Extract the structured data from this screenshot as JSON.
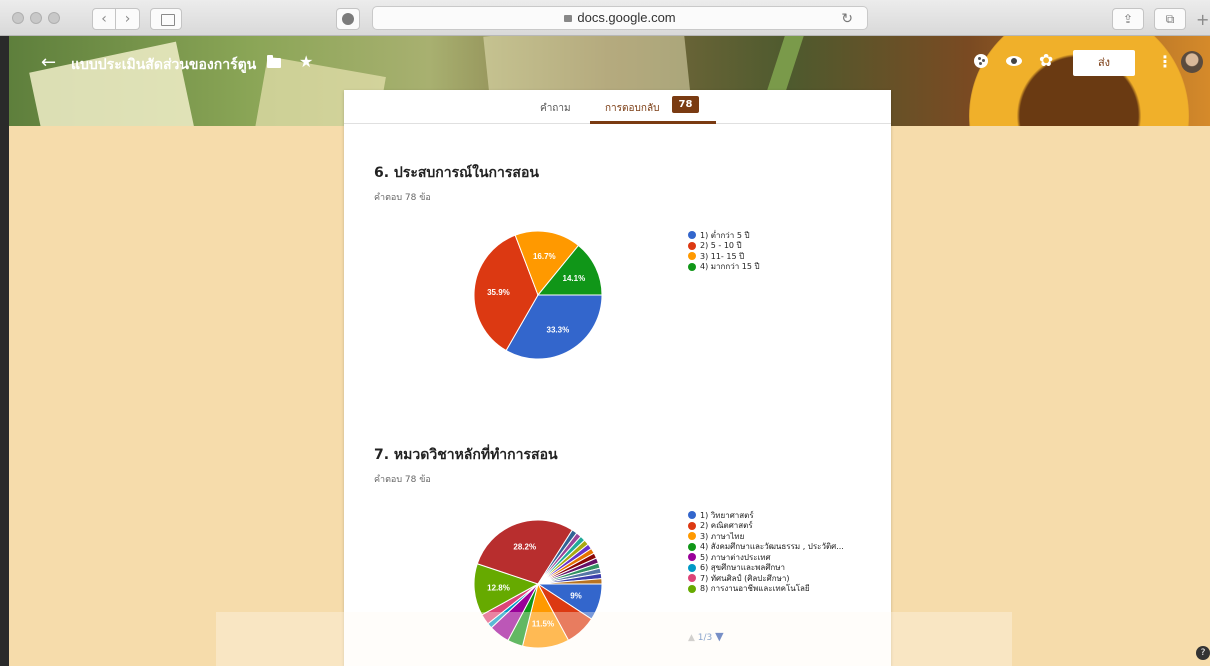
{
  "browser": {
    "url": "docs.google.com"
  },
  "header": {
    "title": "แบบประเมินสัดส่วนของการ์ตูน",
    "send_label": "ส่ง"
  },
  "tabs": {
    "questions_label": "คำถาม",
    "responses_label": "การตอบกลับ",
    "responses_count": "78"
  },
  "questions": [
    {
      "title": "6. ประสบการณ์ในการสอน",
      "subtitle": "คำตอบ 78 ข้อ"
    },
    {
      "title": "7. หมวดวิชาหลักที่ทำการสอน",
      "subtitle": "คำตอบ 78 ข้อ",
      "pager": "1/3"
    }
  ],
  "chart_data": [
    {
      "type": "pie",
      "title": "6. ประสบการณ์ในการสอน",
      "categories": [
        "1) ต่ำกว่า 5 ปี",
        "2) 5 - 10 ปี",
        "3) 11- 15 ปี",
        "4) มากกว่า 15 ปี"
      ],
      "values": [
        33.3,
        35.9,
        16.7,
        14.1
      ],
      "labels": [
        "33.3%",
        "35.9%",
        "16.7%",
        "14.1%"
      ],
      "colors": [
        "#3366cc",
        "#dc3912",
        "#ff9900",
        "#109618"
      ],
      "legend": "right"
    },
    {
      "type": "pie",
      "title": "7. หมวดวิชาหลักที่ทำการสอน",
      "categories": [
        "1) วิทยาศาสตร์",
        "2) คณิตศาสตร์",
        "3) ภาษาไทย",
        "4) สังคมศึกษาและวัฒนธรรม , ประวัติศ...",
        "5) ภาษาต่างประเทศ",
        "6) สุขศึกษาและพลศึกษา",
        "7) ทัศนศิลป์ (ศิลปะศึกษา)",
        "8) การงานอาชีพและเทคโนโลยี"
      ],
      "values": [
        9,
        7.7,
        11.5,
        3.8,
        5.1,
        1.3,
        2.6,
        12.8,
        28.2,
        1.3,
        1.3,
        1.3,
        1.3,
        1.3,
        1.3,
        1.3,
        1.3,
        1.3,
        1.3,
        1.3,
        1.3
      ],
      "labels": [
        "9%",
        "",
        "11.5%",
        "",
        "",
        "",
        "",
        "12.8%",
        "28.2%",
        "",
        "",
        "",
        "",
        "",
        "",
        "",
        "",
        "",
        "",
        "",
        ""
      ],
      "colors": [
        "#3366cc",
        "#dc3912",
        "#ff9900",
        "#109618",
        "#990099",
        "#0099c6",
        "#dd4477",
        "#66aa00",
        "#b82e2e",
        "#316395",
        "#994499",
        "#22aa99",
        "#aaaa11",
        "#6633cc",
        "#e67300",
        "#8b0707",
        "#651067",
        "#329262",
        "#5574a6",
        "#3b3eac",
        "#b77322"
      ],
      "legend": "right"
    }
  ]
}
